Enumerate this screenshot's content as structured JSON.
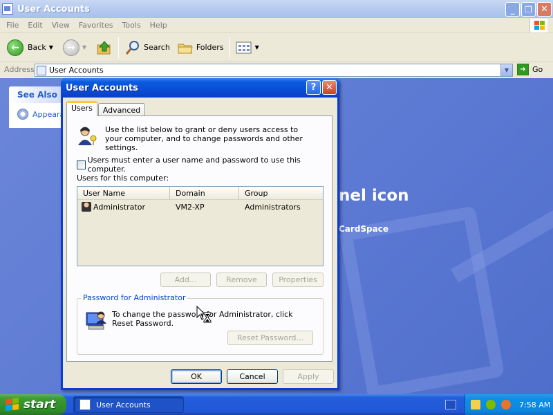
{
  "window": {
    "title": "User Accounts",
    "controls": {
      "minimize": "_",
      "maximize": "❐",
      "close": "✕"
    }
  },
  "menu": [
    "File",
    "Edit",
    "View",
    "Favorites",
    "Tools",
    "Help"
  ],
  "toolbar": {
    "back_label": "Back",
    "search_label": "Search",
    "folders_label": "Folders"
  },
  "address": {
    "label": "Address",
    "value": "User Accounts",
    "go_label": "Go"
  },
  "background": {
    "see_also_title": "See Also",
    "see_also_item": "Appeara",
    "heading_fragment": "nel icon",
    "sub_fragment": "CardSpace"
  },
  "dialog": {
    "title": "User Accounts",
    "help_glyph": "?",
    "close_glyph": "✕",
    "tabs": [
      "Users",
      "Advanced"
    ],
    "active_tab": "Users",
    "intro_text": "Use the list below to grant or deny users access to your computer, and to change passwords and other settings.",
    "require_login_label": "Users must enter a user name and password to use this computer.",
    "require_login_checked": false,
    "users_label": "Users for this computer:",
    "columns": [
      "User Name",
      "Domain",
      "Group"
    ],
    "rows": [
      {
        "user": "Administrator",
        "domain": "VM2-XP",
        "group": "Administrators"
      }
    ],
    "add_label": "Add...",
    "remove_label": "Remove",
    "properties_label": "Properties",
    "password_group_title": "Password for Administrator",
    "password_text": "To change the password for Administrator, click Reset Password.",
    "reset_label": "Reset Password...",
    "ok_label": "OK",
    "cancel_label": "Cancel",
    "apply_label": "Apply"
  },
  "taskbar": {
    "start_label": "start",
    "task_label": "User Accounts",
    "clock": "7:58 AM"
  },
  "colors": {
    "xp_blue": "#0a3dd4",
    "content_bg": "#5a78d2",
    "start_green": "#3c9c34",
    "tray_blue": "#0f8fe6"
  }
}
